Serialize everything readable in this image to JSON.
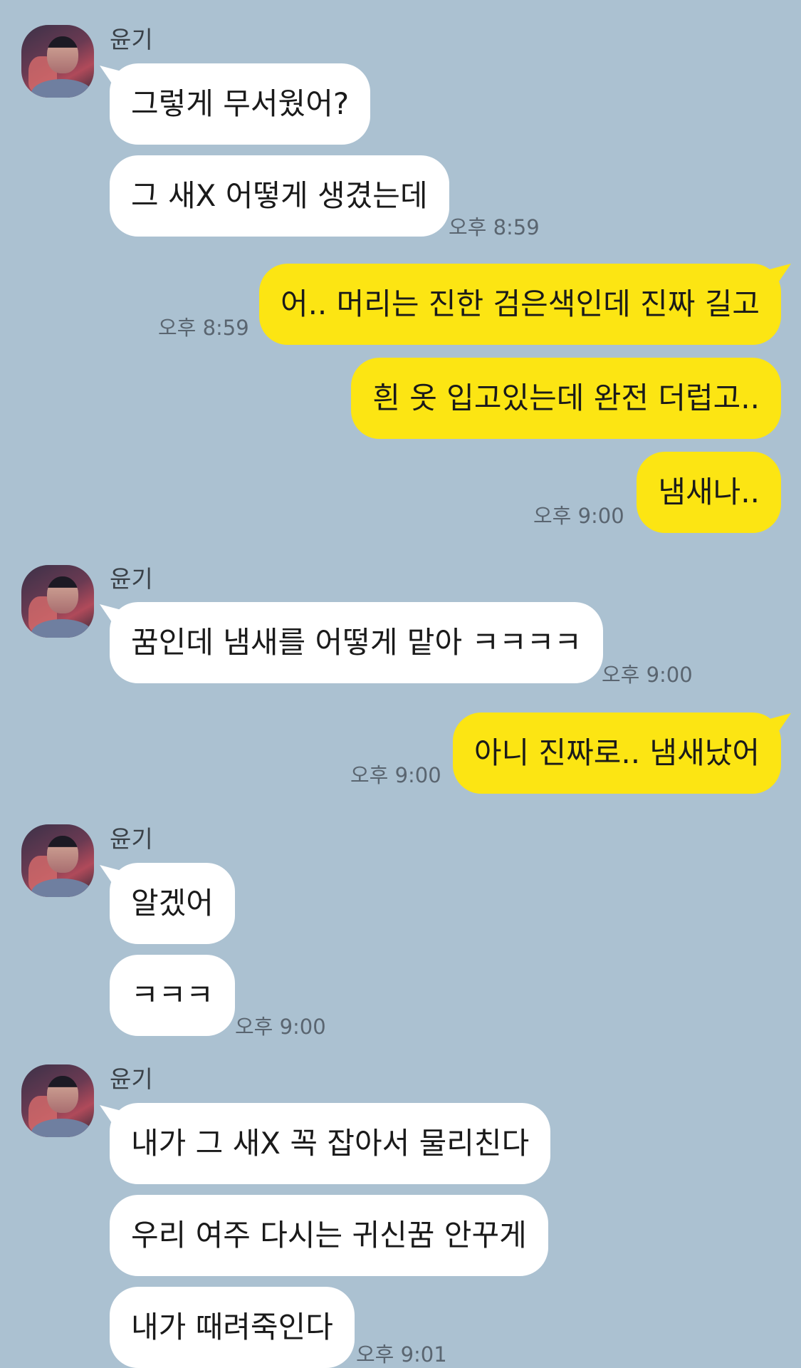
{
  "contact_name": "윤기",
  "messages": [
    {
      "side": "in",
      "text": "그렇게 무서웠어?"
    },
    {
      "side": "in",
      "text": "그 새X 어떻게 생겼는데"
    },
    {
      "side": "out",
      "text": "어.. 머리는 진한 검은색인데 진짜 길고"
    },
    {
      "side": "out",
      "text": "흰 옷 입고있는데 완전 더럽고.."
    },
    {
      "side": "out",
      "text": "냄새나.."
    },
    {
      "side": "in",
      "text": "꿈인데 냄새를 어떻게 맡아 ㅋㅋㅋㅋ"
    },
    {
      "side": "out",
      "text": "아니 진짜로.. 냄새났어"
    },
    {
      "side": "in",
      "text": "알겠어"
    },
    {
      "side": "in",
      "text": "ㅋㅋㅋ"
    },
    {
      "side": "in",
      "text": "내가 그 새X 꼭 잡아서 물리친다"
    },
    {
      "side": "in",
      "text": "우리 여주 다시는 귀신꿈 안꾸게"
    },
    {
      "side": "in",
      "text": "내가 때려죽인다"
    }
  ],
  "timestamps": [
    "오후 8:59",
    "오후 8:59",
    "오후 9:00",
    "오후 9:00",
    "오후 9:00",
    "오후 9:00",
    "오후 9:01"
  ],
  "colors": {
    "background": "#abc1d1",
    "incoming_bubble": "#ffffff",
    "outgoing_bubble": "#fce513"
  }
}
